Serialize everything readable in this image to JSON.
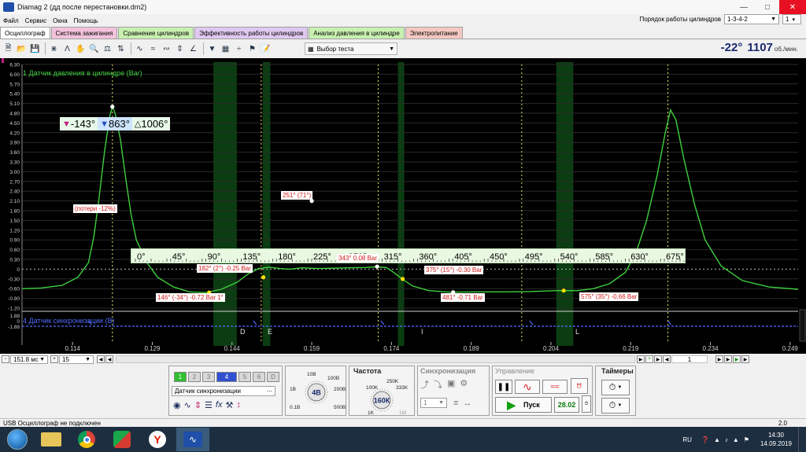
{
  "window": {
    "title": "Diamag 2 (дд после перестановки.dm2)"
  },
  "menu": [
    {
      "name": "menu-file",
      "label": "Файл"
    },
    {
      "name": "menu-service",
      "label": "Сервис"
    },
    {
      "name": "menu-windows",
      "label": "Окна"
    },
    {
      "name": "menu-help",
      "label": "Помощь"
    }
  ],
  "cylinder_order": {
    "label": "Порядок работы цилиндров",
    "value": "1-3-4-2",
    "cylinder": "1"
  },
  "tabs": [
    {
      "name": "tab-oscilloscope",
      "label": "Осциллограф",
      "color": "#ffffff"
    },
    {
      "name": "tab-ignition",
      "label": "Система зажигания",
      "color": "#f2c2dc"
    },
    {
      "name": "tab-cylinder-compare",
      "label": "Сравнение цилиндров",
      "color": "#c8f0b0"
    },
    {
      "name": "tab-cylinder-efficiency",
      "label": "Эффективность работы цилиндров",
      "color": "#e0c8f0"
    },
    {
      "name": "tab-cylinder-pressure",
      "label": "Анализ давления в цилиндре",
      "color": "#c8f0b0"
    },
    {
      "name": "tab-power",
      "label": "Электропитание",
      "color": "#f4c8c0"
    }
  ],
  "toolbar": {
    "test_select": "Выбор теста"
  },
  "readout": {
    "angle": "-22°",
    "rpm": "1107",
    "unit": "об./мин."
  },
  "cursors": {
    "c1": "-143°",
    "c2": "863°",
    "delta": "1006°"
  },
  "channels": {
    "ch1": "1 Датчик давления в цилиндре (Bar)",
    "ch4": "4 Датчик синхронизации (B)"
  },
  "colors": {
    "trace": "#3fcf3f",
    "sync": "#4f6cff",
    "zone": "#0c3d12",
    "grid": "#2a2a2a"
  },
  "y_axis": {
    "ticks": [
      "6.30",
      "6.00",
      "5.70",
      "5.40",
      "5.10",
      "4.80",
      "4.50",
      "4.20",
      "3.90",
      "3.60",
      "3.30",
      "3.00",
      "2.70",
      "2.40",
      "2.10",
      "1.80",
      "1.50",
      "1.20",
      "0.90",
      "0.60",
      "0.30",
      "0",
      "-0.30",
      "-0.60",
      "-0.90",
      "-1.20"
    ],
    "sync_ticks": [
      "1.88",
      "0",
      "-1.88"
    ]
  },
  "time_axis": {
    "ticks": [
      "0.114",
      "0.129",
      "0.144",
      "0.159",
      "0.174",
      "0.189",
      "0.204",
      "0.219",
      "0.234",
      "0.249"
    ]
  },
  "angle_scale": {
    "ticks": [
      "0°",
      "45°",
      "90°",
      "135°",
      "180°",
      "225°",
      "270°",
      "315°",
      "360°",
      "405°",
      "450°",
      "495°",
      "540°",
      "585°",
      "630°",
      "675°"
    ]
  },
  "markers": [
    "D",
    "E",
    "I",
    "L"
  ],
  "annotations": [
    {
      "name": "note-losses",
      "text": "(потери -12%)"
    },
    {
      "name": "note-251",
      "text": "251° (71°)"
    },
    {
      "name": "note-182",
      "text": "182° (2°) -0.25 Bar"
    },
    {
      "name": "note-343",
      "text": "343° 0.08 Bar"
    },
    {
      "name": "note-375",
      "text": "375° (15°) -0.30 Bar"
    },
    {
      "name": "note-146",
      "text": "146° (-34°) -0.72 Bar 1°"
    },
    {
      "name": "note-481",
      "text": "481° -0.71 Bar"
    },
    {
      "name": "note-575",
      "text": "575° (35°) -0.66 Bar"
    }
  ],
  "scroll": {
    "time_value": "151.8 мс",
    "count": "15",
    "page": "1"
  },
  "control": {
    "channel_buttons": [
      "1",
      "2",
      "3",
      "4",
      "5",
      "6",
      "D"
    ],
    "source_select": "Датчик синхронизации",
    "range_title": "",
    "range_value": "4В",
    "range_labels": [
      "10В",
      "100В",
      "200В",
      "500В",
      "0.1В",
      "1В"
    ],
    "freq_title": "Частота",
    "freq_value": "160К",
    "freq_labels": [
      "100K",
      "250K",
      "333K",
      "1K",
      "1M"
    ],
    "sync_title": "Синхронизация",
    "sync_value": "1",
    "manage_title": "Управление",
    "start_label": "Пуск",
    "timer_value": "28.02",
    "timers_title": "Таймеры"
  },
  "status": {
    "left": "USB Осциллограф не подключен",
    "right": "2.0"
  },
  "taskbar": {
    "lang": "RU",
    "time": "14:30",
    "date": "14.09.2019"
  }
}
